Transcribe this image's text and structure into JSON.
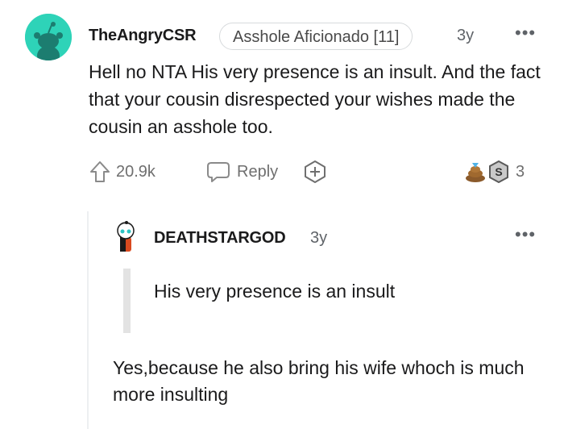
{
  "comment": {
    "author": "TheAngryCSR",
    "flair": "Asshole Aficionado [11]",
    "age": "3y",
    "more_icon": "more-horizontal-icon",
    "more": "•••",
    "body": "Hell no NTA His very presence is an insult. And the fact that your cousin disrespected your wishes made the cousin an asshole too.",
    "upvotes": "20.9k",
    "reply_label": "Reply",
    "awards": {
      "icons": [
        "helpful-award-icon",
        "silver-award-icon"
      ],
      "count": "3"
    },
    "avatar_color": "#2ed3b8"
  },
  "reply": {
    "author": "DEATHSTARGOD",
    "age": "3y",
    "more": "•••",
    "quote": "His very presence is an insult",
    "body": "Yes,because he also bring his wife whoch is much more insulting"
  }
}
